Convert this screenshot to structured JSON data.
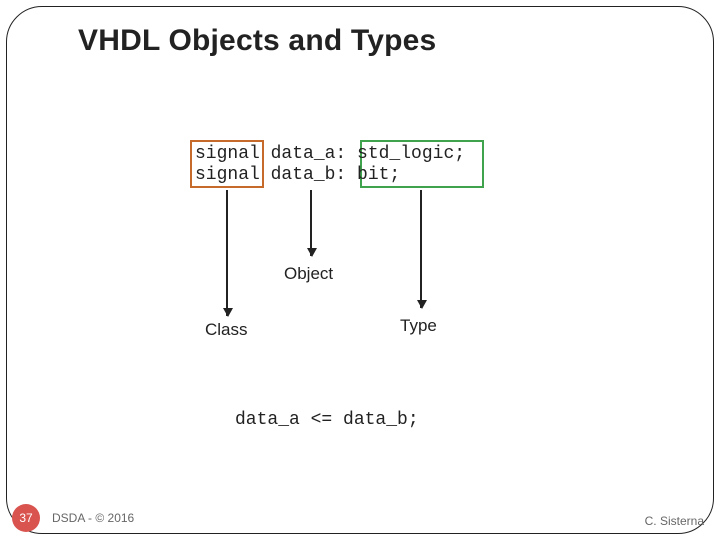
{
  "title": "VHDL Objects and Types",
  "code": {
    "line1": "signal data_a: std_logic;",
    "line2": "signal data_b: bit;",
    "assignment": "data_a <= data_b;"
  },
  "labels": {
    "object": "Object",
    "class": "Class",
    "type": "Type"
  },
  "footer": {
    "page": "37",
    "left": "DSDA - © 2016",
    "right": "C. Sisterna"
  }
}
